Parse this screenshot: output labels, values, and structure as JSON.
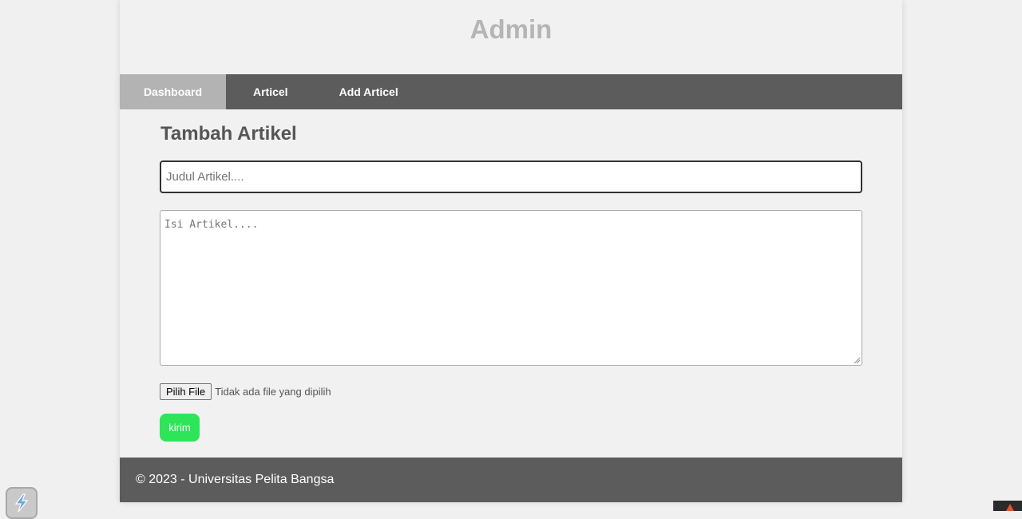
{
  "header": {
    "title": "Admin"
  },
  "nav": {
    "items": [
      {
        "label": "Dashboard",
        "active": true
      },
      {
        "label": "Articel",
        "active": false
      },
      {
        "label": "Add Articel",
        "active": false
      }
    ]
  },
  "form": {
    "heading": "Tambah Artikel",
    "title_placeholder": "Judul Artikel....",
    "title_value": "",
    "body_placeholder": "Isi Artikel....",
    "body_value": "",
    "file_button_label": "Pilih File",
    "file_status": "Tidak ada file yang dipilih",
    "submit_label": "kirim"
  },
  "footer": {
    "text": "© 2023 - Universitas Pelita Bangsa"
  },
  "colors": {
    "nav_bg": "#5c5c5c",
    "nav_active_bg": "#b3b3b3",
    "submit_bg": "#2ee55a",
    "header_text": "#b5b5b5",
    "footer_bg": "#5c5c5c"
  },
  "icons": {
    "corner_widget": "extension-lightning-icon",
    "corner_dark": "warning-triangle-icon"
  }
}
